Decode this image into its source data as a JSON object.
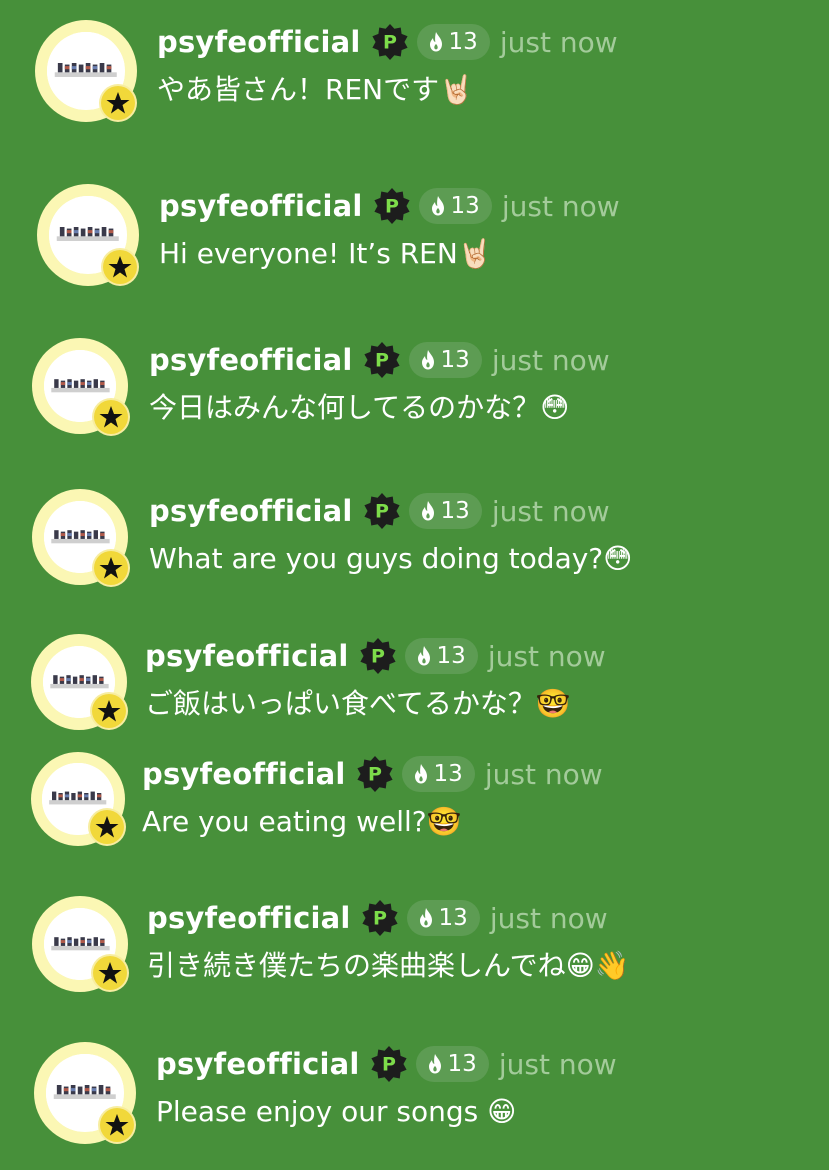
{
  "chat": {
    "messages": [
      {
        "username": "psyfeofficial",
        "badge": "P",
        "fire_count": "13",
        "time": "just now",
        "text": "やあ皆さん！RENです🤘🏻"
      },
      {
        "username": "psyfeofficial",
        "badge": "P",
        "fire_count": "13",
        "time": "just now",
        "text": "Hi everyone! It’s REN🤘🏻"
      },
      {
        "username": "psyfeofficial",
        "badge": "P",
        "fire_count": "13",
        "time": "just now",
        "text": "今日はみんな何してるのかな？😳"
      },
      {
        "username": "psyfeofficial",
        "badge": "P",
        "fire_count": "13",
        "time": "just now",
        "text": "What are you guys doing today?😳"
      },
      {
        "username": "psyfeofficial",
        "badge": "P",
        "fire_count": "13",
        "time": "just now",
        "text": "ご飯はいっぱい食べてるかな？🤓"
      },
      {
        "username": "psyfeofficial",
        "badge": "P",
        "fire_count": "13",
        "time": "just now",
        "text": "Are you eating well?🤓"
      },
      {
        "username": "psyfeofficial",
        "badge": "P",
        "fire_count": "13",
        "time": "just now",
        "text": "引き続き僕たちの楽曲楽しんでね😁👋"
      },
      {
        "username": "psyfeofficial",
        "badge": "P",
        "fire_count": "13",
        "time": "just now",
        "text": "Please enjoy our songs 😁"
      }
    ]
  },
  "icons": {
    "avatar_badge": "star-icon",
    "verified_badge": "p-badge-icon",
    "streak": "fire-icon"
  },
  "colors": {
    "background": "#47903a",
    "avatar_ring": "#fbf7b4",
    "star_badge": "#f1d83a",
    "p_badge": "#1d1d1d",
    "p_letter": "#7ddc4a",
    "pill": "#5d9c53",
    "time_text": "#a3cb9a"
  }
}
